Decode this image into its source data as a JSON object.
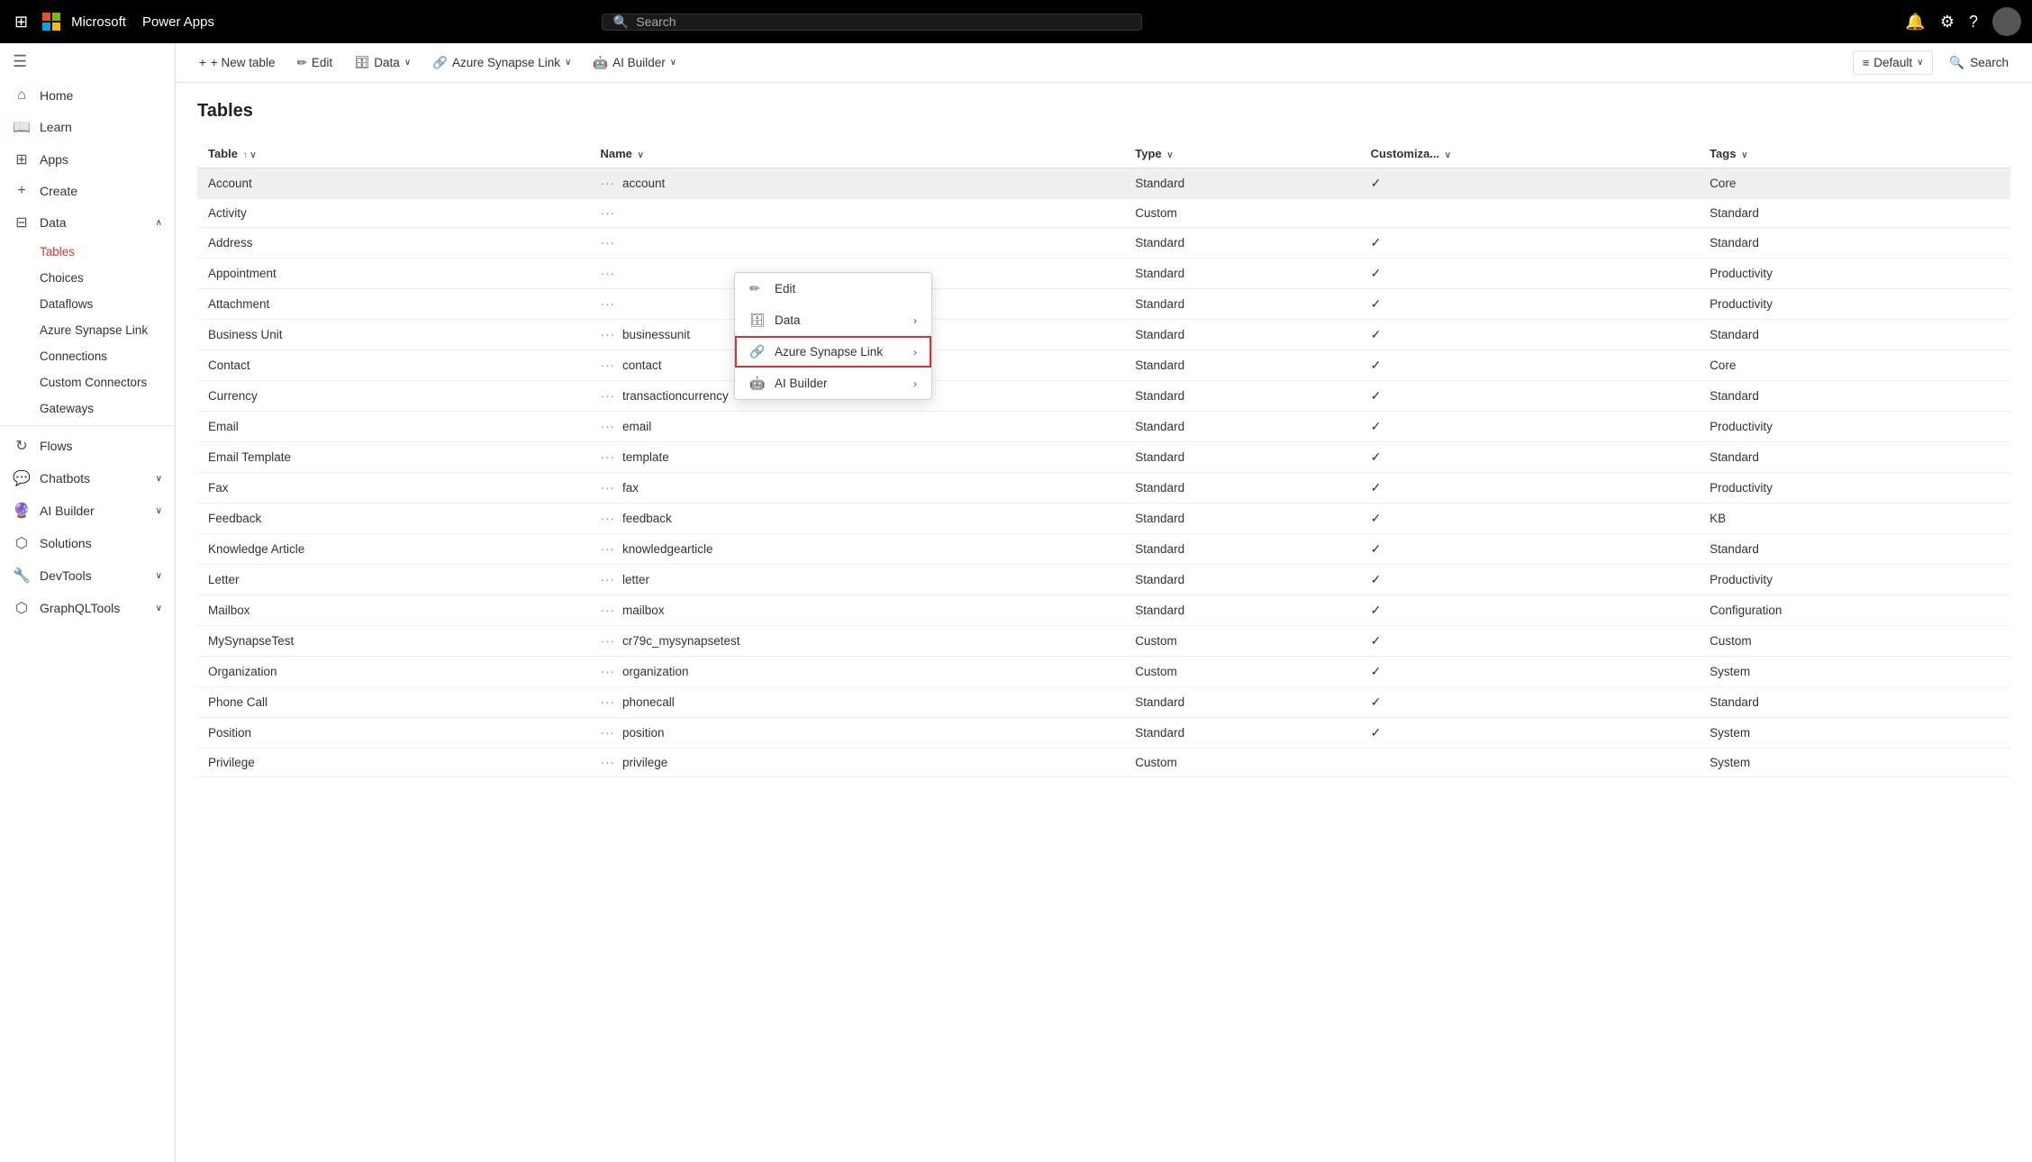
{
  "topnav": {
    "app_name": "Power Apps",
    "ms_company": "Microsoft",
    "search_placeholder": "Search"
  },
  "toolbar": {
    "new_table": "+ New table",
    "edit": "Edit",
    "data": "Data",
    "azure_synapse_link": "Azure Synapse Link",
    "ai_builder": "AI Builder",
    "default": "Default",
    "search": "Search"
  },
  "page": {
    "title": "Tables"
  },
  "columns": [
    {
      "label": "Table",
      "sort": "↑ ∨"
    },
    {
      "label": "Name",
      "sort": "∨"
    },
    {
      "label": "Type",
      "sort": "∨"
    },
    {
      "label": "Customiza...",
      "sort": "∨"
    },
    {
      "label": "Tags",
      "sort": "∨"
    }
  ],
  "rows": [
    {
      "table": "Account",
      "name": "account",
      "type": "Standard",
      "customizable": true,
      "tags": "Core",
      "selected": true
    },
    {
      "table": "Activity",
      "name": "",
      "type": "Custom",
      "customizable": false,
      "tags": "Standard",
      "selected": false
    },
    {
      "table": "Address",
      "name": "",
      "type": "Standard",
      "customizable": true,
      "tags": "Standard",
      "selected": false
    },
    {
      "table": "Appointment",
      "name": "",
      "type": "Standard",
      "customizable": true,
      "tags": "Productivity",
      "selected": false
    },
    {
      "table": "Attachment",
      "name": "",
      "type": "Standard",
      "customizable": true,
      "tags": "Productivity",
      "selected": false
    },
    {
      "table": "Business Unit",
      "name": "businessunit",
      "type": "Standard",
      "customizable": true,
      "tags": "Standard",
      "selected": false
    },
    {
      "table": "Contact",
      "name": "contact",
      "type": "Standard",
      "customizable": true,
      "tags": "Core",
      "selected": false
    },
    {
      "table": "Currency",
      "name": "transactioncurrency",
      "type": "Standard",
      "customizable": true,
      "tags": "Standard",
      "selected": false
    },
    {
      "table": "Email",
      "name": "email",
      "type": "Standard",
      "customizable": true,
      "tags": "Productivity",
      "selected": false
    },
    {
      "table": "Email Template",
      "name": "template",
      "type": "Standard",
      "customizable": true,
      "tags": "Standard",
      "selected": false
    },
    {
      "table": "Fax",
      "name": "fax",
      "type": "Standard",
      "customizable": true,
      "tags": "Productivity",
      "selected": false
    },
    {
      "table": "Feedback",
      "name": "feedback",
      "type": "Standard",
      "customizable": true,
      "tags": "KB",
      "selected": false
    },
    {
      "table": "Knowledge Article",
      "name": "knowledgearticle",
      "type": "Standard",
      "customizable": true,
      "tags": "Standard",
      "selected": false
    },
    {
      "table": "Letter",
      "name": "letter",
      "type": "Standard",
      "customizable": true,
      "tags": "Productivity",
      "selected": false
    },
    {
      "table": "Mailbox",
      "name": "mailbox",
      "type": "Standard",
      "customizable": true,
      "tags": "Configuration",
      "selected": false
    },
    {
      "table": "MySynapseTest",
      "name": "cr79c_mysynapsetest",
      "type": "Custom",
      "customizable": true,
      "tags": "Custom",
      "selected": false
    },
    {
      "table": "Organization",
      "name": "organization",
      "type": "Custom",
      "customizable": true,
      "tags": "System",
      "selected": false
    },
    {
      "table": "Phone Call",
      "name": "phonecall",
      "type": "Standard",
      "customizable": true,
      "tags": "Standard",
      "selected": false
    },
    {
      "table": "Position",
      "name": "position",
      "type": "Standard",
      "customizable": true,
      "tags": "System",
      "selected": false
    },
    {
      "table": "Privilege",
      "name": "privilege",
      "type": "Custom",
      "customizable": false,
      "tags": "System",
      "selected": false
    }
  ],
  "context_menu": {
    "items": [
      {
        "label": "Edit",
        "icon": "✏️",
        "has_arrow": false
      },
      {
        "label": "Data",
        "icon": "🗄️",
        "has_arrow": true
      },
      {
        "label": "Azure Synapse Link",
        "icon": "🔗",
        "has_arrow": true,
        "highlighted": true
      },
      {
        "label": "AI Builder",
        "icon": "🤖",
        "has_arrow": true
      }
    ]
  },
  "sidebar": {
    "items": [
      {
        "id": "home",
        "label": "Home",
        "icon": "⌂"
      },
      {
        "id": "learn",
        "label": "Learn",
        "icon": "📖"
      },
      {
        "id": "apps",
        "label": "Apps",
        "icon": "⊞"
      },
      {
        "id": "create",
        "label": "Create",
        "icon": "+"
      },
      {
        "id": "data",
        "label": "Data",
        "icon": "⊟",
        "expanded": true
      },
      {
        "id": "flows",
        "label": "Flows",
        "icon": "↻"
      },
      {
        "id": "chatbots",
        "label": "Chatbots",
        "icon": "💬",
        "has_chevron": true
      },
      {
        "id": "ai-builder",
        "label": "AI Builder",
        "icon": "🔮",
        "has_chevron": true
      },
      {
        "id": "solutions",
        "label": "Solutions",
        "icon": "⬡"
      },
      {
        "id": "devtools",
        "label": "DevTools",
        "icon": "🔧",
        "has_chevron": true
      },
      {
        "id": "graphql-tools",
        "label": "GraphQLTools",
        "icon": "⬡",
        "has_chevron": true
      }
    ],
    "data_subitems": [
      {
        "id": "tables",
        "label": "Tables",
        "active": true
      },
      {
        "id": "choices",
        "label": "Choices"
      },
      {
        "id": "dataflows",
        "label": "Dataflows"
      },
      {
        "id": "azure-synapse-link",
        "label": "Azure Synapse Link"
      },
      {
        "id": "connections",
        "label": "Connections"
      },
      {
        "id": "custom-connectors",
        "label": "Custom Connectors"
      },
      {
        "id": "gateways",
        "label": "Gateways"
      }
    ]
  }
}
